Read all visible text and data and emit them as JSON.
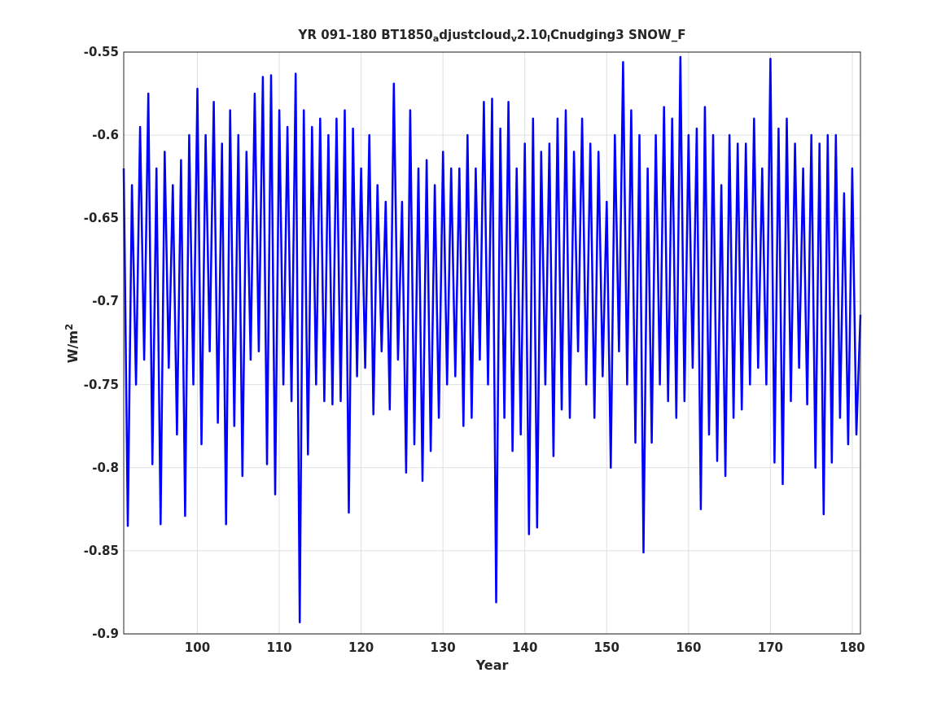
{
  "figure": {
    "chart_data": {
      "type": "line",
      "title": "YR 091-180 BT1850$_{a}$djustcloud$_{v}$2.10$_{l}$Cnudging3 SNOW_F",
      "xlabel": "Year",
      "ylabel": "W/m$^{2}$",
      "xlim": [
        91,
        181
      ],
      "ylim": [
        -0.9,
        -0.55
      ],
      "grid": true,
      "xticks": [
        100,
        110,
        120,
        130,
        140,
        150,
        160,
        170,
        180
      ],
      "yticks": [
        {
          "value": -0.9,
          "label": "-0.9"
        },
        {
          "value": -0.85,
          "label": "-0.85"
        },
        {
          "value": -0.8,
          "label": "-0.8"
        },
        {
          "value": -0.75,
          "label": "-0.75"
        },
        {
          "value": -0.7,
          "label": "-0.7"
        },
        {
          "value": -0.65,
          "label": "-0.65"
        },
        {
          "value": -0.6,
          "label": "-0.6"
        },
        {
          "value": -0.55,
          "label": "-0.55"
        }
      ],
      "x": [
        91,
        91.5,
        92,
        92.5,
        93,
        93.5,
        94,
        94.5,
        95,
        95.5,
        96,
        96.5,
        97,
        97.5,
        98,
        98.5,
        99,
        99.5,
        100,
        100.5,
        101,
        101.5,
        102,
        102.5,
        103,
        103.5,
        104,
        104.5,
        105,
        105.5,
        106,
        106.5,
        107,
        107.5,
        108,
        108.5,
        109,
        109.5,
        110,
        110.5,
        111,
        111.5,
        112,
        112.5,
        113,
        113.5,
        114,
        114.5,
        115,
        115.5,
        116,
        116.5,
        117,
        117.5,
        118,
        118.5,
        119,
        119.5,
        120,
        120.5,
        121,
        121.5,
        122,
        122.5,
        123,
        123.5,
        124,
        124.5,
        125,
        125.5,
        126,
        126.5,
        127,
        127.5,
        128,
        128.5,
        129,
        129.5,
        130,
        130.5,
        131,
        131.5,
        132,
        132.5,
        133,
        133.5,
        134,
        134.5,
        135,
        135.5,
        136,
        136.5,
        137,
        137.5,
        138,
        138.5,
        139,
        139.5,
        140,
        140.5,
        141,
        141.5,
        142,
        142.5,
        143,
        143.5,
        144,
        144.5,
        145,
        145.5,
        146,
        146.5,
        147,
        147.5,
        148,
        148.5,
        149,
        149.5,
        150,
        150.5,
        151,
        151.5,
        152,
        152.5,
        153,
        153.5,
        154,
        154.5,
        155,
        155.5,
        156,
        156.5,
        157,
        157.5,
        158,
        158.5,
        159,
        159.5,
        160,
        160.5,
        161,
        161.5,
        162,
        162.5,
        163,
        163.5,
        164,
        164.5,
        165,
        165.5,
        166,
        166.5,
        167,
        167.5,
        168,
        168.5,
        169,
        169.5,
        170,
        170.5,
        171,
        171.5,
        172,
        172.5,
        173,
        173.5,
        174,
        174.5,
        175,
        175.5,
        176,
        176.5,
        177,
        177.5,
        178,
        178.5,
        179,
        179.5,
        180,
        180.5,
        181
      ],
      "series": [
        {
          "color": "#0000ff",
          "values": [
            -0.62,
            -0.835,
            -0.63,
            -0.75,
            -0.595,
            -0.735,
            -0.575,
            -0.798,
            -0.62,
            -0.834,
            -0.61,
            -0.74,
            -0.63,
            -0.78,
            -0.615,
            -0.829,
            -0.6,
            -0.75,
            -0.572,
            -0.786,
            -0.6,
            -0.73,
            -0.58,
            -0.773,
            -0.605,
            -0.834,
            -0.585,
            -0.775,
            -0.6,
            -0.805,
            -0.61,
            -0.735,
            -0.575,
            -0.73,
            -0.565,
            -0.798,
            -0.564,
            -0.816,
            -0.585,
            -0.75,
            -0.595,
            -0.76,
            -0.563,
            -0.893,
            -0.585,
            -0.792,
            -0.595,
            -0.75,
            -0.59,
            -0.76,
            -0.6,
            -0.762,
            -0.59,
            -0.76,
            -0.585,
            -0.827,
            -0.596,
            -0.745,
            -0.62,
            -0.74,
            -0.6,
            -0.768,
            -0.63,
            -0.73,
            -0.64,
            -0.765,
            -0.569,
            -0.735,
            -0.64,
            -0.803,
            -0.585,
            -0.786,
            -0.62,
            -0.808,
            -0.615,
            -0.79,
            -0.63,
            -0.77,
            -0.61,
            -0.75,
            -0.62,
            -0.745,
            -0.62,
            -0.775,
            -0.6,
            -0.77,
            -0.62,
            -0.735,
            -0.58,
            -0.75,
            -0.578,
            -0.881,
            -0.596,
            -0.77,
            -0.58,
            -0.79,
            -0.62,
            -0.78,
            -0.605,
            -0.84,
            -0.59,
            -0.836,
            -0.61,
            -0.75,
            -0.605,
            -0.793,
            -0.59,
            -0.765,
            -0.585,
            -0.77,
            -0.61,
            -0.73,
            -0.59,
            -0.75,
            -0.605,
            -0.77,
            -0.61,
            -0.745,
            -0.64,
            -0.8,
            -0.6,
            -0.73,
            -0.556,
            -0.75,
            -0.585,
            -0.785,
            -0.6,
            -0.851,
            -0.62,
            -0.785,
            -0.6,
            -0.75,
            -0.583,
            -0.76,
            -0.59,
            -0.77,
            -0.553,
            -0.76,
            -0.6,
            -0.74,
            -0.596,
            -0.825,
            -0.583,
            -0.78,
            -0.6,
            -0.796,
            -0.63,
            -0.805,
            -0.6,
            -0.77,
            -0.605,
            -0.765,
            -0.605,
            -0.75,
            -0.59,
            -0.74,
            -0.62,
            -0.75,
            -0.554,
            -0.797,
            -0.596,
            -0.81,
            -0.59,
            -0.76,
            -0.605,
            -0.74,
            -0.62,
            -0.762,
            -0.6,
            -0.8,
            -0.605,
            -0.828,
            -0.6,
            -0.797,
            -0.6,
            -0.77,
            -0.635,
            -0.786,
            -0.62,
            -0.78,
            -0.708
          ]
        }
      ]
    }
  }
}
